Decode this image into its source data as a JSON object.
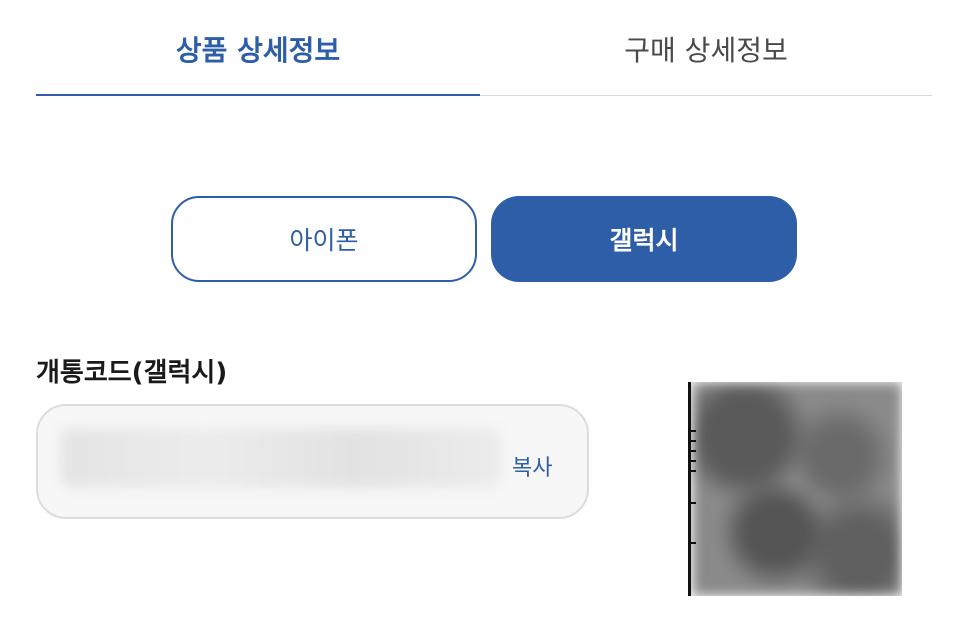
{
  "tabs": [
    {
      "label": "상품 상세정보",
      "active": true
    },
    {
      "label": "구매 상세정보",
      "active": false
    }
  ],
  "device_buttons": {
    "iphone": "아이폰",
    "galaxy": "갤럭시",
    "selected": "galaxy"
  },
  "activation_code": {
    "label": "개통코드(갤럭시)",
    "copy_label": "복사"
  },
  "colors": {
    "accent": "#2f5ea8",
    "border": "#dcdcdc",
    "field_bg": "#f7f7f7"
  }
}
